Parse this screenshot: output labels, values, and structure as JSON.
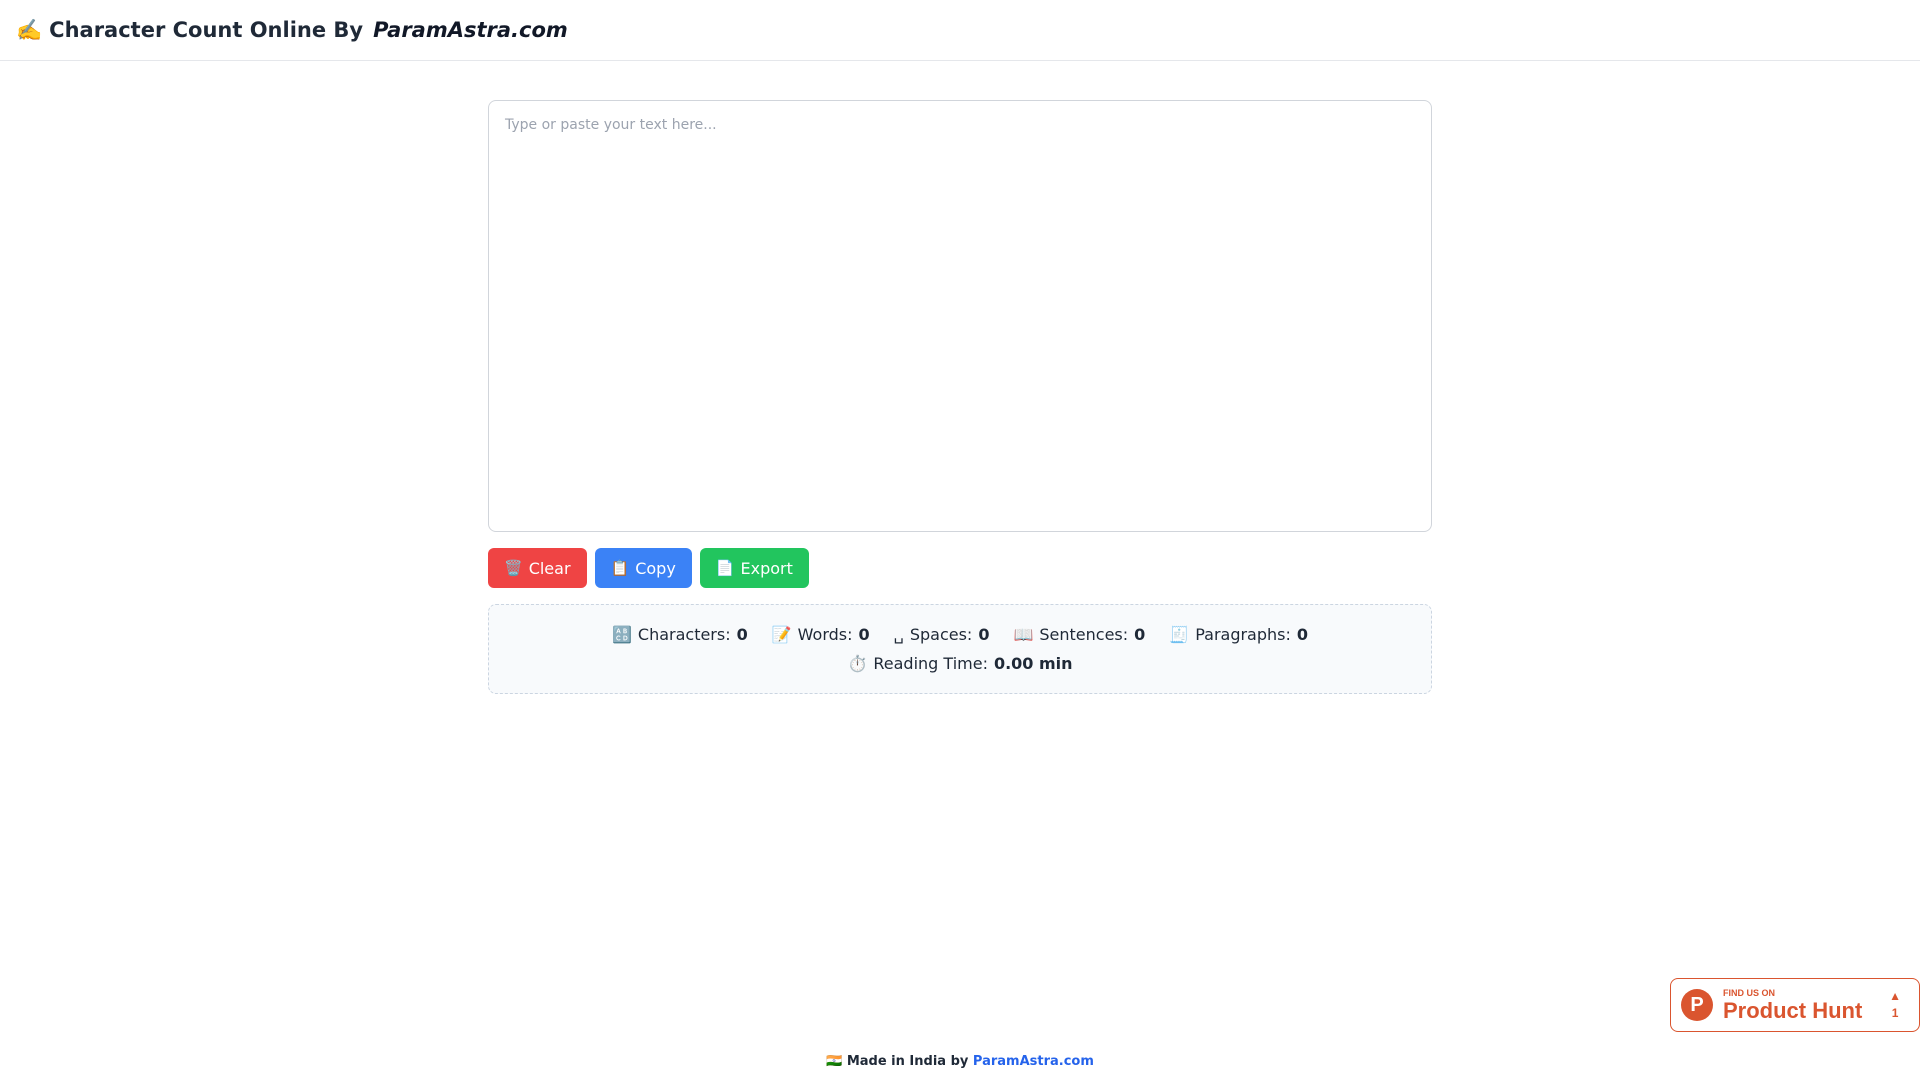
{
  "header": {
    "emoji": "✍️",
    "title": "Character Count Online By",
    "brand": "ParamAstra.com"
  },
  "editor": {
    "placeholder": "Type or paste your text here...",
    "value": ""
  },
  "buttons": {
    "clear": {
      "icon": "🗑️",
      "label": "Clear"
    },
    "copy": {
      "icon": "📋",
      "label": "Copy"
    },
    "export": {
      "icon": "📄",
      "label": "Export"
    }
  },
  "stats": {
    "characters": {
      "icon": "🔠",
      "label": "Characters:",
      "value": "0"
    },
    "words": {
      "icon": "📝",
      "label": "Words:",
      "value": "0"
    },
    "spaces": {
      "icon": "␣",
      "label": "Spaces:",
      "value": "0"
    },
    "sentences": {
      "icon": "📖",
      "label": "Sentences:",
      "value": "0"
    },
    "paragraphs": {
      "icon": "🧾",
      "label": "Paragraphs:",
      "value": "0"
    },
    "reading_time": {
      "icon": "⏱️",
      "label": "Reading Time:",
      "value": "0.00 min"
    }
  },
  "product_hunt": {
    "logo_letter": "P",
    "small": "FIND US ON",
    "big": "Product Hunt",
    "arrow": "▲",
    "votes": "1"
  },
  "footer": {
    "flag": "🇮🇳",
    "text": "Made in India by",
    "link": "ParamAstra.com"
  },
  "colors": {
    "clear": "#ef4444",
    "copy": "#3b82f6",
    "export": "#22c55e",
    "product_hunt": "#da552f",
    "link": "#2563eb"
  }
}
